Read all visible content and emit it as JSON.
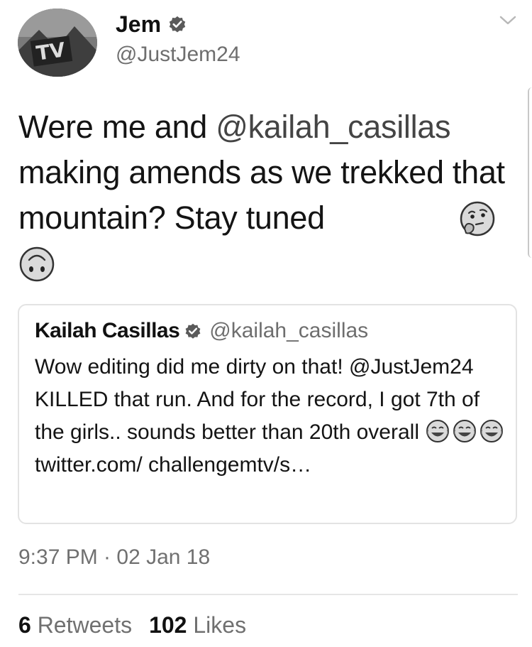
{
  "tweet": {
    "display_name": "Jem",
    "handle": "@JustJem24",
    "avatar_label": "TV",
    "text_before": "Were me and ",
    "text_mention": "@kailah_casillas",
    "text_after": " making amends as we trekked that mountain? Stay tuned",
    "emojis": [
      "thinking-face-icon",
      "upside-down-face-icon"
    ],
    "timestamp": "9:37 PM · 02 Jan 18",
    "retweets_count": "6",
    "retweets_label": "Retweets",
    "likes_count": "102",
    "likes_label": "Likes"
  },
  "quoted": {
    "display_name": "Kailah Casillas",
    "handle": "@kailah_casillas",
    "text_main": "Wow editing did me dirty on that! @JustJem24 KILLED that run. And for the record, I got 7th of the girls.. sounds better than 20th overall",
    "text_link": "twitter.com/ challengemtv/s…",
    "emoji_count": 3
  },
  "colors": {
    "text": "#141414",
    "secondary": "#6e6e6e",
    "border": "#e3e3e3"
  }
}
